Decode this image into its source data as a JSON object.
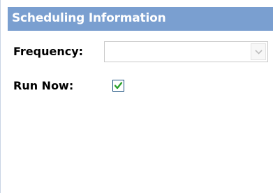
{
  "panel": {
    "title": "Scheduling Information"
  },
  "fields": {
    "frequency": {
      "label": "Frequency:",
      "value": "",
      "options": []
    },
    "run_now": {
      "label": "Run Now:",
      "checked": true
    }
  },
  "icons": {
    "dropdown": "chevron-down-icon",
    "check": "checkmark-icon"
  },
  "colors": {
    "header_bg": "#7a9fd0",
    "header_text": "#ffffff",
    "check_green": "#2aa02a",
    "checkbox_border": "#1c5180"
  }
}
